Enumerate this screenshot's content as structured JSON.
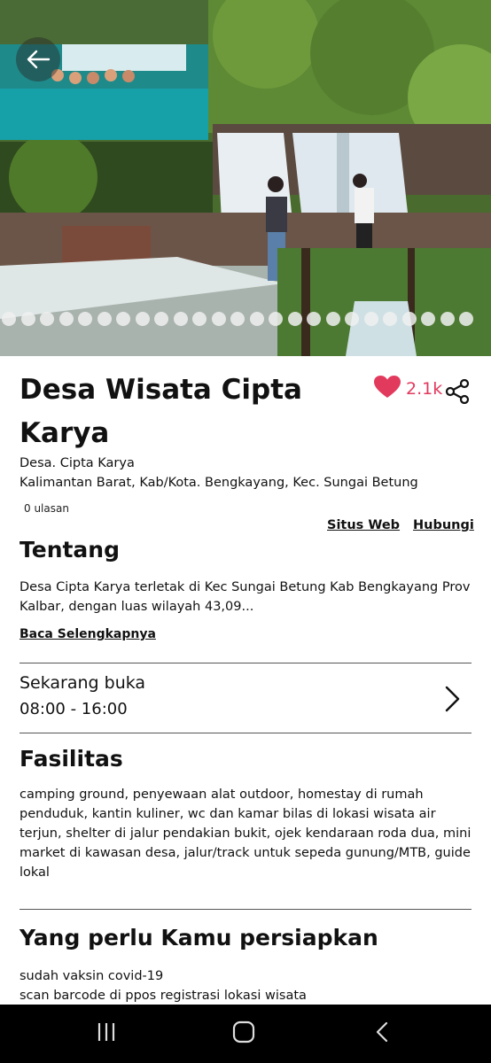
{
  "place": {
    "title": "Desa Wisata Cipta Karya",
    "address_line1": "Desa. Cipta Karya",
    "address_line2": "Kalimantan Barat, Kab/Kota. Bengkayang, Kec. Sungai Betung",
    "reviews": "0 ulasan",
    "likes": "2.1k"
  },
  "links": {
    "website": "Situs Web",
    "contact": "Hubungi"
  },
  "about": {
    "heading": "Tentang",
    "text": "Desa Cipta Karya terletak di Kec Sungai Betung Kab Bengkayang Prov Kalbar, dengan luas wilayah 43,09...",
    "read_more": "Baca Selengkapnya"
  },
  "hours": {
    "status": "Sekarang buka",
    "time": "08:00 - 16:00"
  },
  "facilities": {
    "heading": "Fasilitas",
    "text": "camping ground, penyewaan alat outdoor, homestay di rumah penduduk, kantin kuliner, wc dan kamar bilas di lokasi wisata air terjun, shelter di jalur pendakian bukit, ojek kendaraan roda dua, mini market di kawasan desa, jalur/track untuk sepeda gunung/MTB, guide lokal"
  },
  "prepare": {
    "heading": "Yang perlu Kamu persiapkan",
    "items": [
      "sudah vaksin covid-19",
      "scan barcode di ppos registrasi lokasi wisata"
    ]
  },
  "gallery": {
    "dot_count": 25
  },
  "colors": {
    "accent": "#e23a5d",
    "navbar": "#000000"
  },
  "icons": {
    "back": "arrow-left-icon",
    "like": "heart-icon",
    "share": "share-icon",
    "chevron": "chevron-right-icon"
  }
}
